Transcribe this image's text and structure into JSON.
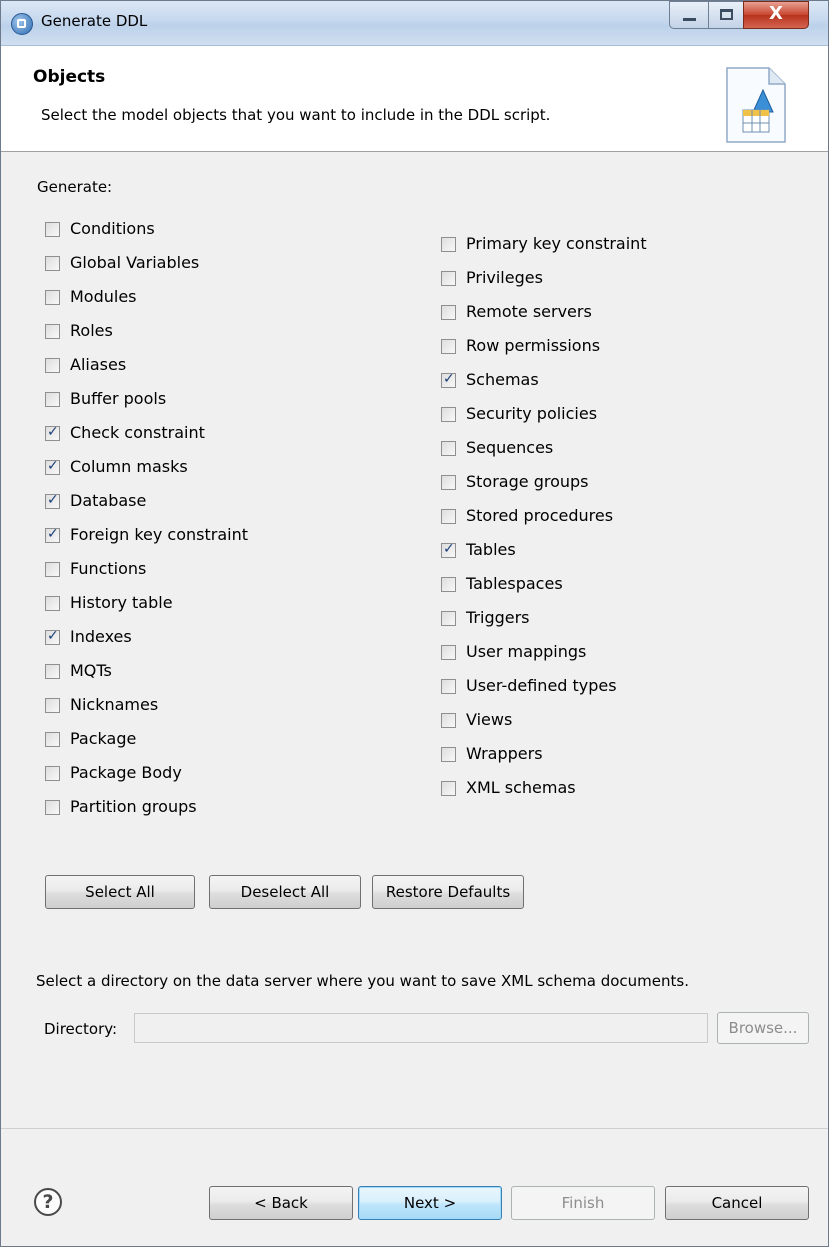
{
  "window": {
    "title": "Generate DDL",
    "minimize_icon": "minimize-icon",
    "maximize_icon": "maximize-icon",
    "close_label": "X"
  },
  "banner": {
    "title": "Objects",
    "description": "Select the model objects that you want to include in the DDL script.",
    "icon": "ddl-script-icon"
  },
  "generate_label": "Generate:",
  "objects_left": [
    {
      "label": "Conditions",
      "checked": false
    },
    {
      "label": "Global Variables",
      "checked": false
    },
    {
      "label": "Modules",
      "checked": false
    },
    {
      "label": "Roles",
      "checked": false
    },
    {
      "label": "Aliases",
      "checked": false
    },
    {
      "label": "Buffer pools",
      "checked": false
    },
    {
      "label": "Check constraint",
      "checked": true
    },
    {
      "label": "Column masks",
      "checked": true
    },
    {
      "label": "Database",
      "checked": true
    },
    {
      "label": "Foreign key constraint",
      "checked": true
    },
    {
      "label": "Functions",
      "checked": false
    },
    {
      "label": "History table",
      "checked": false
    },
    {
      "label": "Indexes",
      "checked": true
    },
    {
      "label": "MQTs",
      "checked": false
    },
    {
      "label": "Nicknames",
      "checked": false
    },
    {
      "label": "Package",
      "checked": false
    },
    {
      "label": "Package Body",
      "checked": false
    },
    {
      "label": "Partition groups",
      "checked": false
    }
  ],
  "objects_right": [
    {
      "label": "Primary key constraint",
      "checked": false
    },
    {
      "label": "Privileges",
      "checked": false
    },
    {
      "label": "Remote servers",
      "checked": false
    },
    {
      "label": "Row permissions",
      "checked": false
    },
    {
      "label": "Schemas",
      "checked": true
    },
    {
      "label": "Security policies",
      "checked": false
    },
    {
      "label": "Sequences",
      "checked": false
    },
    {
      "label": "Storage groups",
      "checked": false
    },
    {
      "label": "Stored procedures",
      "checked": false
    },
    {
      "label": "Tables",
      "checked": true
    },
    {
      "label": "Tablespaces",
      "checked": false
    },
    {
      "label": "Triggers",
      "checked": false
    },
    {
      "label": "User mappings",
      "checked": false
    },
    {
      "label": "User-defined types",
      "checked": false
    },
    {
      "label": "Views",
      "checked": false
    },
    {
      "label": "Wrappers",
      "checked": false
    },
    {
      "label": "XML schemas",
      "checked": false
    }
  ],
  "selection_buttons": {
    "select_all": "Select All",
    "deselect_all": "Deselect All",
    "restore_defaults": "Restore Defaults"
  },
  "directory": {
    "description": "Select a directory on the data server where you want to save XML schema documents.",
    "label": "Directory:",
    "value": "",
    "browse_label": "Browse...",
    "browse_enabled": false
  },
  "footer": {
    "help_icon": "help-icon",
    "back_label": "< Back",
    "next_label": "Next >",
    "finish_label": "Finish",
    "finish_enabled": false,
    "cancel_label": "Cancel"
  }
}
